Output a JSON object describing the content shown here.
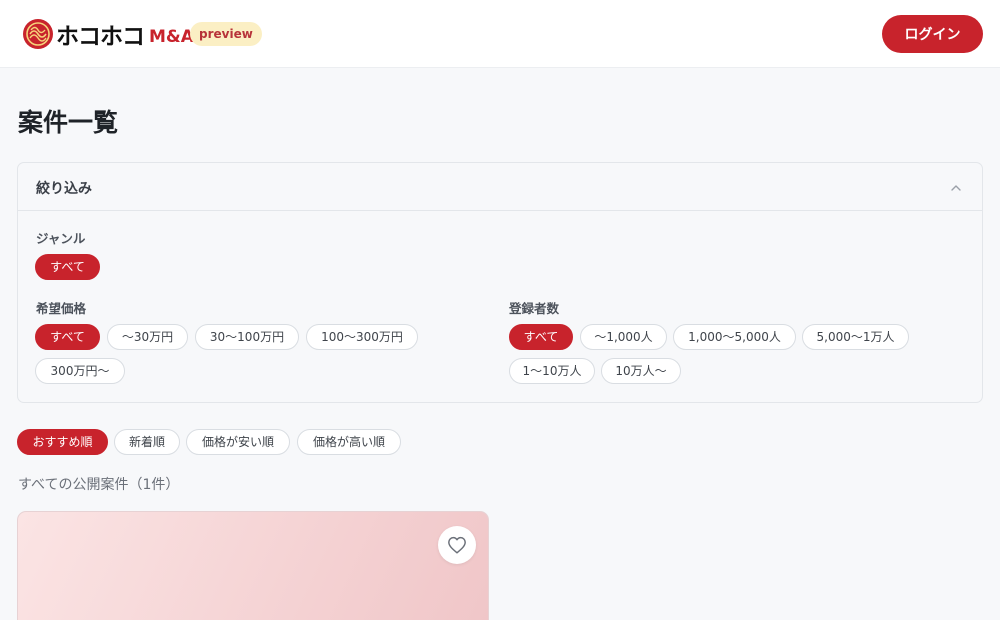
{
  "header": {
    "logo_text": "ホコホコ",
    "logo_suffix": "M&A",
    "badge": "preview",
    "login_label": "ログイン",
    "brand_color": "#c8232c"
  },
  "page": {
    "title": "案件一覧"
  },
  "filters": {
    "title": "絞り込み",
    "genre": {
      "label": "ジャンル",
      "options": [
        "すべて"
      ],
      "selected": "すべて"
    },
    "price": {
      "label": "希望価格",
      "options": [
        "すべて",
        "〜30万円",
        "30〜100万円",
        "100〜300万円",
        "300万円〜"
      ],
      "selected": "すべて"
    },
    "registrants": {
      "label": "登録者数",
      "options": [
        "すべて",
        "〜1,000人",
        "1,000〜5,000人",
        "5,000〜1万人",
        "1〜10万人",
        "10万人〜"
      ],
      "selected": "すべて"
    }
  },
  "sort": {
    "options": [
      "おすすめ順",
      "新着順",
      "価格が安い順",
      "価格が高い順"
    ],
    "selected": "おすすめ順"
  },
  "results": {
    "summary": "すべての公開案件（1件）"
  },
  "icons": {
    "collapse": "chevron-up-icon",
    "favorite": "heart-icon"
  }
}
